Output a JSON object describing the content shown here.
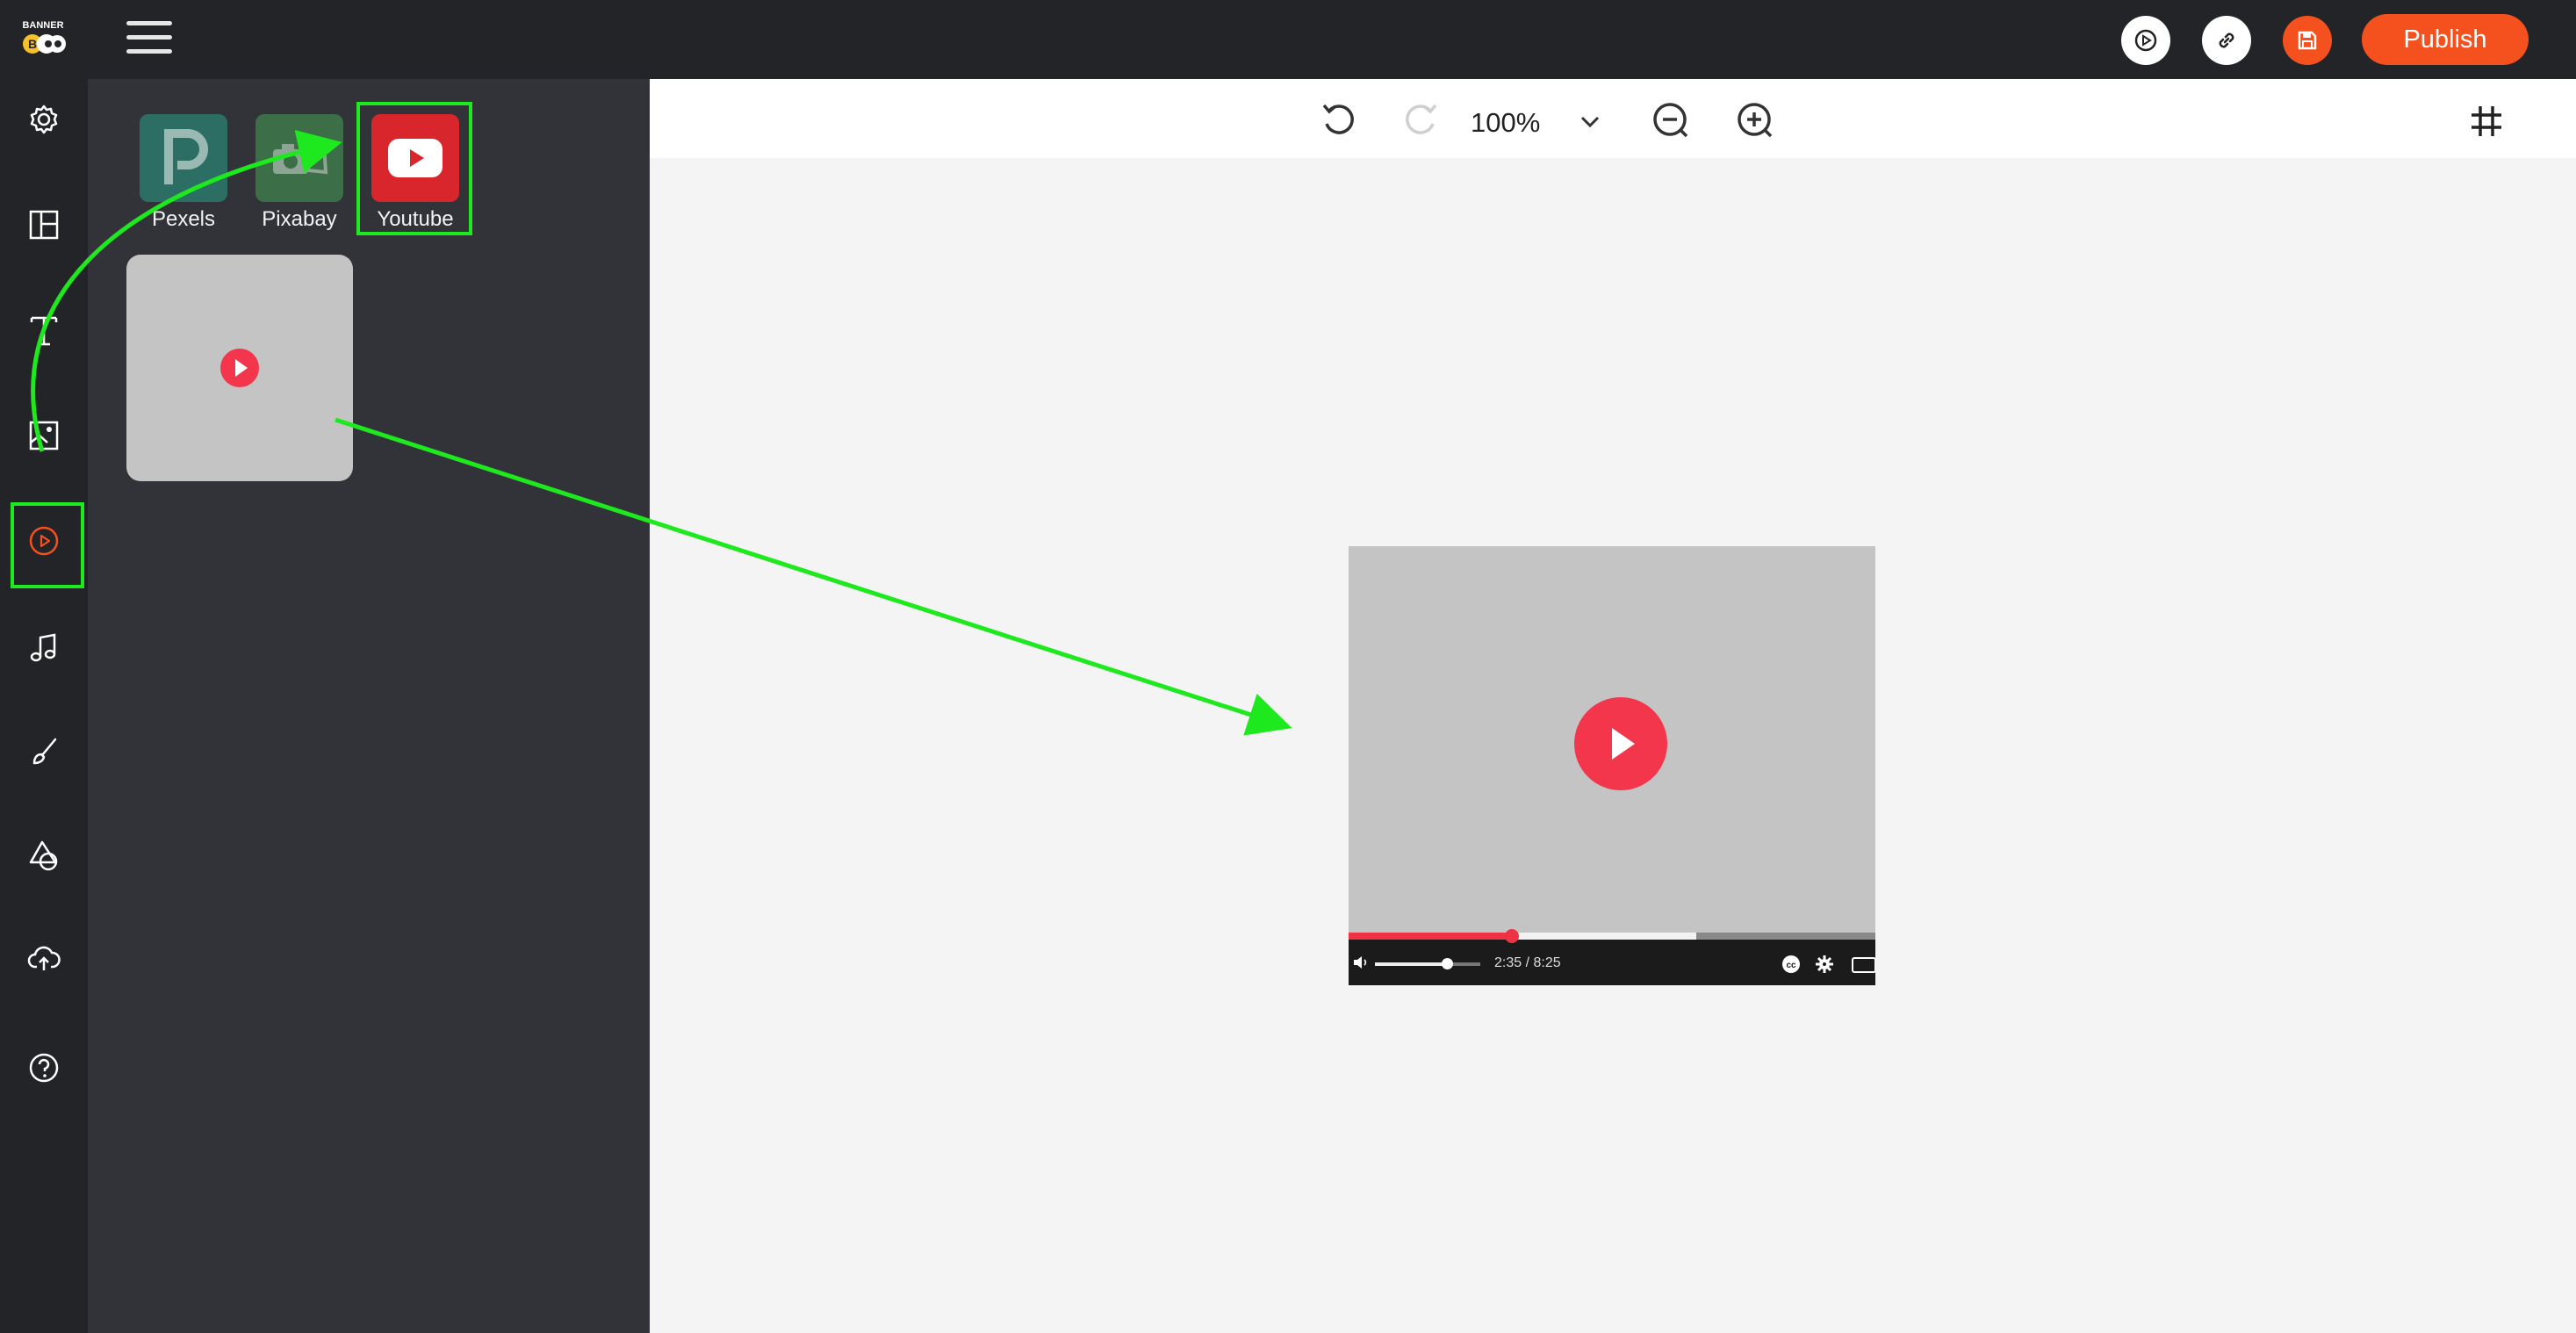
{
  "app": {
    "logo_text": "BANNER BOO"
  },
  "panel": {
    "sources": [
      {
        "label": "Pexels",
        "color": "#2c6e63",
        "icon": "pexels-icon"
      },
      {
        "label": "Pixabay",
        "color": "#3c6e47",
        "icon": "pixabay-camera-icon"
      },
      {
        "label": "Youtube",
        "color": "#d8262c",
        "icon": "youtube-icon"
      }
    ],
    "thumbnail_icon": "play-icon"
  },
  "toolbar": {
    "zoom": "100%",
    "publish_label": "Publish"
  },
  "rail": {
    "items": [
      "settings-icon",
      "layout-icon",
      "text-icon",
      "image-icon",
      "video-icon",
      "music-icon",
      "brush-icon",
      "shapes-icon",
      "upload-icon",
      "help-icon"
    ],
    "active": "video-icon"
  },
  "video_player": {
    "time": "2:35 / 8:25",
    "progress_fraction": 0.31,
    "buffered_fraction": 0.66,
    "volume_fraction": 0.68
  },
  "colors": {
    "accent": "#f4511e",
    "highlight": "#1ee81e",
    "dark_bg": "#232427",
    "panel_bg": "#323339",
    "youtube_red": "#f4364c"
  }
}
